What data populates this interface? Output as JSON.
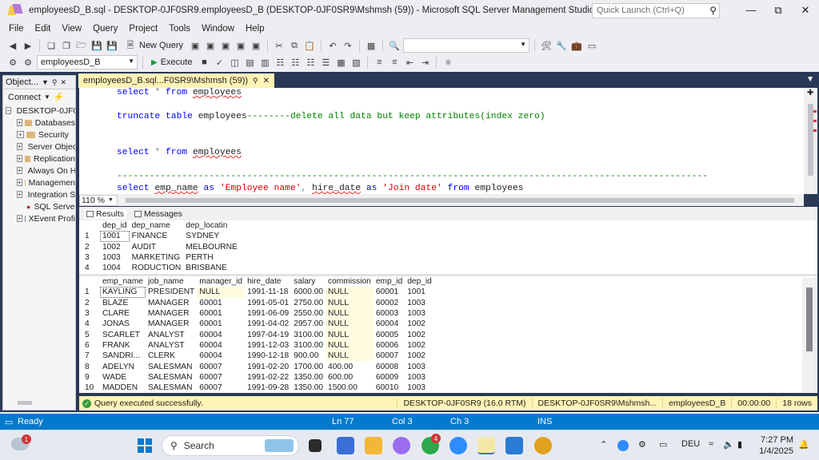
{
  "window": {
    "title": "employeesD_B.sql - DESKTOP-0JF0SR9.employeesD_B (DESKTOP-0JF0SR9\\Mshmsh (59)) - Microsoft SQL Server Management Studio",
    "quick_launch_placeholder": "Quick Launch (Ctrl+Q)",
    "controls": [
      "—",
      "⧉",
      "✕"
    ]
  },
  "menu": [
    "File",
    "Edit",
    "View",
    "Query",
    "Project",
    "Tools",
    "Window",
    "Help"
  ],
  "toolbar": {
    "new_query": "New Query",
    "database": "employeesD_B",
    "execute": "Execute"
  },
  "object_explorer": {
    "title": "Object...",
    "connect": "Connect",
    "server": "DESKTOP-0JF0",
    "nodes": [
      "Databases",
      "Security",
      "Server Objec",
      "Replication",
      "Always On H",
      "Managemen",
      "Integration S",
      "SQL Server A",
      "XEvent Profi"
    ]
  },
  "editor": {
    "tab_label": "employeesD_B.sql...F0SR9\\Mshmsh (59))",
    "zoom": "110 %",
    "lines": {
      "l1_kw": "select",
      "l1_star": "*",
      "l1_from": "from",
      "l1_tbl": "employees",
      "l2_kw": "truncate table",
      "l2_tbl": "employees",
      "l2_comment": "--------delete all data but keep attributes(index zero)",
      "l3_kw": "select",
      "l3_star": "*",
      "l3_from": "from",
      "l3_tbl": "employees",
      "l4_comment": "-------------------------------------------------------------------------------------------------------------",
      "l5_select": "select",
      "l5_col1": "emp_name",
      "l5_as1": "as",
      "l5_str1": "'Employee name'",
      "l5_comma": ",",
      "l5_col2": "hire_date",
      "l5_as2": "as",
      "l5_str2": "'Join date'",
      "l5_from": "from",
      "l5_tbl": "employees"
    }
  },
  "results": {
    "tabs": [
      "Results",
      "Messages"
    ],
    "grid1": {
      "columns": [
        "dep_id",
        "dep_name",
        "dep_locatin"
      ],
      "rows": [
        [
          "1",
          "1001",
          "FINANCE",
          "SYDNEY"
        ],
        [
          "2",
          "1002",
          "AUDIT",
          "MELBOURNE"
        ],
        [
          "3",
          "1003",
          "MARKETING",
          "PERTH"
        ],
        [
          "4",
          "1004",
          "RODUCTION",
          "BRISBANE"
        ]
      ]
    },
    "grid2": {
      "columns": [
        "emp_name",
        "job_name",
        "manager_id",
        "hire_date",
        "salary",
        "commission",
        "emp_id",
        "dep_id"
      ],
      "rows": [
        [
          "1",
          "KAYLING",
          "PRESIDENT",
          "NULL",
          "1991-11-18",
          "6000.00",
          "NULL",
          "60001",
          "1001"
        ],
        [
          "2",
          "BLAZE",
          "MANAGER",
          "60001",
          "1991-05-01",
          "2750.00",
          "NULL",
          "60002",
          "1003"
        ],
        [
          "3",
          "CLARE",
          "MANAGER",
          "60001",
          "1991-06-09",
          "2550.00",
          "NULL",
          "60003",
          "1003"
        ],
        [
          "4",
          "JONAS",
          " MANAGER",
          "60001",
          "1991-04-02",
          "2957.00",
          "NULL",
          "60004",
          "1002"
        ],
        [
          "5",
          "SCARLET",
          " ANALYST",
          "60004",
          "1997-04-19",
          "3100.00",
          "NULL",
          "60005",
          "1002"
        ],
        [
          "6",
          "FRANK",
          "ANALYST",
          "60004",
          "1991-12-03",
          "3100.00",
          "NULL",
          "60006",
          "1002"
        ],
        [
          "7",
          "SANDRI...",
          "CLERK",
          "60004",
          "1990-12-18",
          "900.00",
          "NULL",
          "60007",
          "1002"
        ],
        [
          "8",
          "ADELYN",
          "SALESMAN",
          "60007",
          "1991-02-20",
          "1700.00",
          "400.00",
          "60008",
          "1003"
        ],
        [
          "9",
          " WADE",
          " SALESMAN",
          "60007",
          "1991-02-22",
          "1350.00",
          "600.00",
          "60009",
          "1003"
        ],
        [
          "10",
          "MADDEN",
          "SALESMAN",
          "60007",
          "1991-09-28",
          "1350.00",
          "1500.00",
          "60010",
          "1003"
        ]
      ]
    }
  },
  "query_status": {
    "message": "Query executed successfully.",
    "server": "DESKTOP-0JF0SR9 (16.0 RTM)",
    "user": "DESKTOP-0JF0SR9\\Mshmsh...",
    "database": "employeesD_B",
    "elapsed": "00:00:00",
    "rows": "18 rows"
  },
  "status_bar": {
    "ready": "Ready",
    "ln": "Ln 77",
    "col": "Col 3",
    "ch": "Ch 3",
    "mode": "INS"
  },
  "taskbar": {
    "search": "Search",
    "weather_badge": "1",
    "whatsapp_badge": "4",
    "lang": "DEU",
    "time": "7:27 PM",
    "date": "1/4/2025"
  },
  "colors": {
    "workspace": "#293955",
    "active_tab": "#fff3b5",
    "statusbar": "#007acc",
    "keyword": "#0000ff",
    "string": "#d00000",
    "comment": "#008000"
  }
}
